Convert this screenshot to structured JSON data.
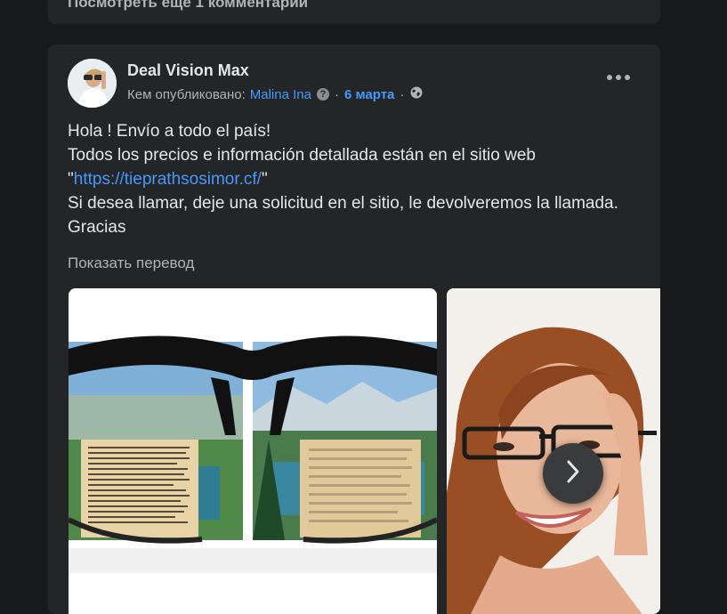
{
  "previous_post": {
    "view_more_comments": "Посмотреть еще 1 комментарий"
  },
  "post": {
    "page_name": "Deal Vision Max",
    "posted_by_label": "Кем опубликовано:",
    "author": "Malina Ina",
    "separator": "·",
    "date": "6 марта",
    "body_line1": "Hola ! Envío a todo el país!",
    "body_line2": "Todos los precios e información detallada están en el sitio web",
    "body_quote_open": "\"",
    "body_link": "https://tieprathsosimor.cf/",
    "body_quote_close": "\"",
    "body_line4": "Si desea llamar, deje una solicitud en el sitio, le devolveremos la llamada. Gracias",
    "show_translation": "Показать перевод",
    "icons": {
      "info": "question-circle-icon",
      "privacy": "globe-icon",
      "more": "more-options-icon",
      "next": "chevron-right-icon"
    },
    "accent_color": "#4599ff"
  }
}
